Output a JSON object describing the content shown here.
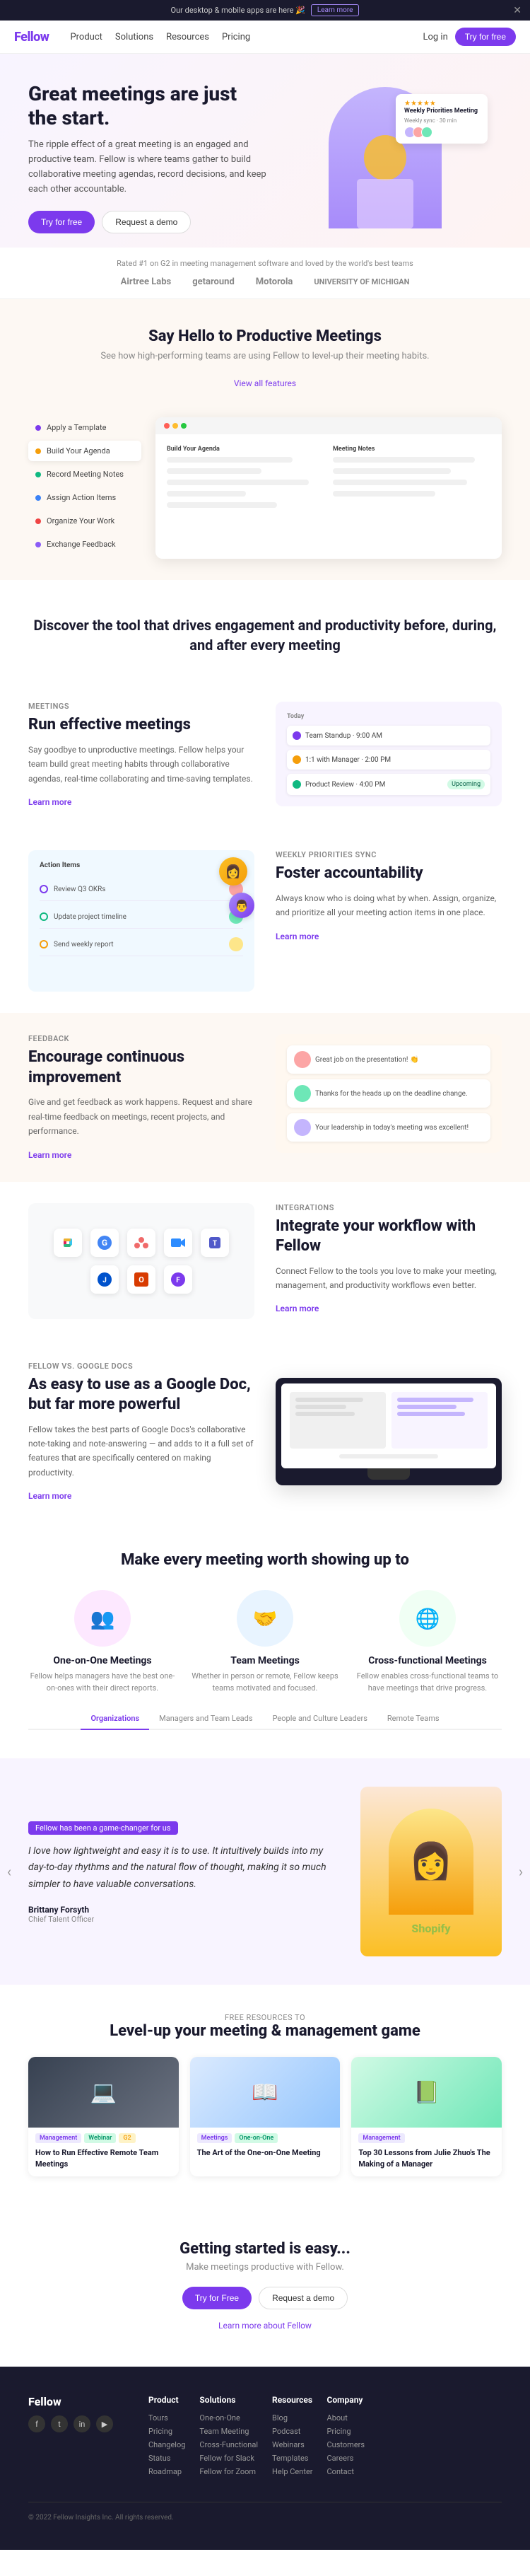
{
  "banner": {
    "text": "Our desktop & mobile apps are here 🎉",
    "cta": "Learn more"
  },
  "nav": {
    "logo": "Fellow",
    "links": [
      "Product",
      "Solutions",
      "Resources",
      "Pricing"
    ],
    "login": "Log in",
    "cta": "Try for free"
  },
  "hero": {
    "title": "Great meetings are just the start.",
    "subtitle": "The ripple effect of a great meeting is an engaged and productive team. Fellow is where teams gather to build collaborative meeting agendas, record decisions, and keep each other accountable.",
    "cta_primary": "Try for free",
    "cta_secondary": "Request a demo",
    "card": {
      "title": "Weekly Priorities Meeting",
      "subtitle": "Weekly sync · 30 min",
      "stars": "★★★★★"
    }
  },
  "social_proof": {
    "text": "Rated #1 on G2 in meeting management software and loved by the world's best teams",
    "logos": [
      "Airtree Labs",
      "getaround",
      "Motorola",
      "UNIVERSITY OF MICHIGAN"
    ]
  },
  "say_hello": {
    "title": "Say Hello to Productive Meetings",
    "subtitle": "See how high-performing teams are using Fellow to level-up their meeting habits.",
    "link": "View all features"
  },
  "showcase": {
    "items": [
      {
        "label": "Apply a Template",
        "color": "#7c3aed",
        "active": false
      },
      {
        "label": "Build Your Agenda",
        "color": "#f59e0b",
        "active": true
      },
      {
        "label": "Record Meeting Notes",
        "color": "#10b981",
        "active": false
      },
      {
        "label": "Assign Action Items",
        "color": "#3b82f6",
        "active": false
      },
      {
        "label": "Organize Your Work",
        "color": "#ef4444",
        "active": false
      },
      {
        "label": "Exchange Feedback",
        "color": "#8b5cf6",
        "active": false
      }
    ]
  },
  "discover": {
    "title": "Discover the tool that drives engagement and productivity before, during, and after every meeting"
  },
  "features": [
    {
      "tag": "Meetings",
      "title": "Run effective meetings",
      "desc": "Say goodbye to unproductive meetings. Fellow helps your team build great meeting habits through collaborative agendas, real-time collaborating and time-saving templates.",
      "link": "Learn more",
      "side": "left"
    },
    {
      "tag": "Weekly Priorities Sync",
      "title": "Foster accountability",
      "desc": "Always know who is doing what by when. Assign, organize, and prioritize all your meeting action items in one place.",
      "link": "Learn more",
      "side": "right"
    },
    {
      "tag": "Feedback",
      "title": "Encourage continuous improvement",
      "desc": "Give and get feedback as work happens. Request and share real-time feedback on meetings, recent projects, and performance.",
      "link": "Learn more",
      "side": "left"
    },
    {
      "tag": "Integrations",
      "title": "Integrate your workflow with Fellow",
      "desc": "Connect Fellow to the tools you love to make your meeting, management, and productivity workflows even better.",
      "link": "Learn more",
      "side": "right"
    }
  ],
  "comparison": {
    "tag": "Fellow vs. Google Docs",
    "title": "As easy to use as a Google Doc, but far more powerful",
    "desc": "Fellow takes the best parts of Google Docs's collaborative note-taking and note-answering — and adds to it a full set of features that are specifically centered on making productivity.",
    "link": "Learn more"
  },
  "meeting_types": {
    "title": "Make every meeting worth showing up to",
    "types": [
      {
        "name": "One-on-One Meetings",
        "desc": "Fellow helps managers have the best one-on-ones with their direct reports.",
        "emoji": "👥",
        "bg": "#fde8ff"
      },
      {
        "name": "Team Meetings",
        "desc": "Whether in person or remote, Fellow keeps teams motivated and focused.",
        "emoji": "🤝",
        "bg": "#e8f4ff"
      },
      {
        "name": "Cross-functional Meetings",
        "desc": "Fellow enables cross-functional teams to have meetings that drive progress.",
        "emoji": "🌐",
        "bg": "#f0fff4"
      }
    ],
    "tabs": [
      "Organizations",
      "Managers and Team Leads",
      "People and Culture Leaders",
      "Remote Teams"
    ]
  },
  "testimonial": {
    "highlight": "Fellow has been a game-changer for us",
    "quote": "I love how lightweight and easy it is to use. It intuitively builds into my day-to-day rhythms and the natural flow of thought, making it so much simpler to have valuable conversations.",
    "author": "Brittany Forsyth",
    "role": "Chief Talent Officer",
    "company": "Shopify"
  },
  "resources": {
    "tag": "Free Resources to",
    "title": "Level-up your meeting & management game",
    "cards": [
      {
        "tags": [
          {
            "label": "Management",
            "color": "#7c3aed",
            "bg": "#ede9fe"
          },
          {
            "label": "Webinar",
            "color": "#059669",
            "bg": "#d1fae5"
          },
          {
            "label": "G2",
            "color": "#f59e0b",
            "bg": "#fef3c7"
          }
        ],
        "title": "How to Run Effective Remote Team Meetings"
      },
      {
        "tags": [
          {
            "label": "Meetings",
            "color": "#7c3aed",
            "bg": "#ede9fe"
          },
          {
            "label": "One-on-One",
            "color": "#059669",
            "bg": "#d1fae5"
          }
        ],
        "title": "The Art of the One-on-One Meeting"
      },
      {
        "tags": [
          {
            "label": "Management",
            "color": "#7c3aed",
            "bg": "#ede9fe"
          }
        ],
        "title": "Top 30 Lessons from Julie Zhuo's The Making of a Manager"
      }
    ]
  },
  "getting_started": {
    "title": "Getting started is easy...",
    "subtitle": "Make meetings productive with Fellow.",
    "cta_primary": "Try for Free",
    "cta_secondary": "Request a demo",
    "sub_text": "Learn more about Fellow"
  },
  "footer": {
    "logo": "Fellow",
    "social": [
      "f",
      "t",
      "in",
      "yt"
    ],
    "columns": [
      {
        "title": "Product",
        "links": [
          "Tours",
          "Pricing",
          "Changelog",
          "Status",
          "Roadmap"
        ]
      },
      {
        "title": "Solutions",
        "links": [
          "One-on-One",
          "Team Meeting",
          "Cross-Functional",
          "Fellow for Slack",
          "Fellow for Zoom"
        ]
      },
      {
        "title": "Resources",
        "links": [
          "Blog",
          "Podcast",
          "Webinars",
          "Templates",
          "Help Center"
        ]
      },
      {
        "title": "Company",
        "links": [
          "About",
          "Pricing",
          "Customers",
          "Careers",
          "Contact"
        ]
      }
    ],
    "bottom": "© 2022 Fellow Insights Inc. All rights reserved."
  },
  "integrations": {
    "icons": [
      "🔴",
      "📊",
      "🤝",
      "📆",
      "⚡",
      "🔵",
      "📝",
      "💬"
    ]
  }
}
